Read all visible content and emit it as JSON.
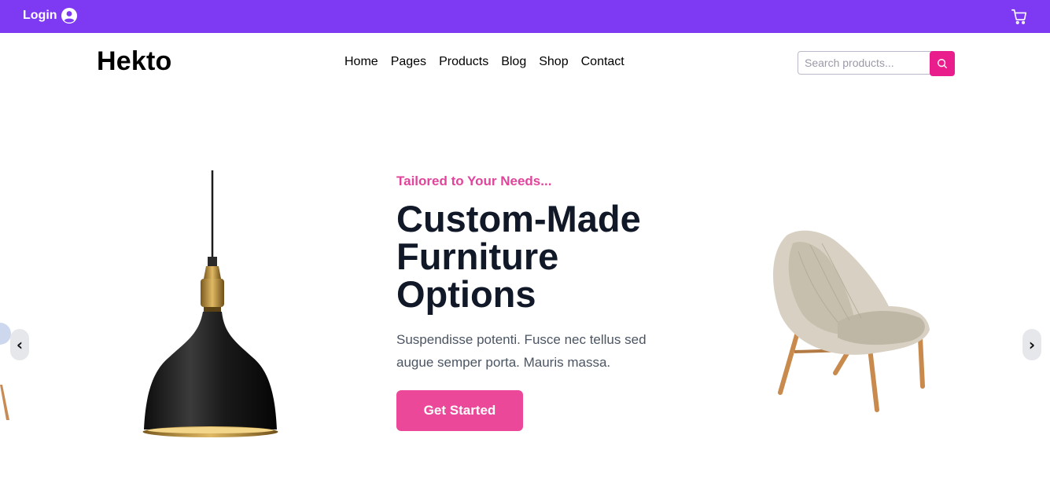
{
  "topbar": {
    "login_label": "Login",
    "user_icon": "user-circle-icon",
    "cart_icon": "cart-icon",
    "background": "#7e3af2"
  },
  "header": {
    "logo": "Hekto",
    "nav": [
      "Home",
      "Pages",
      "Products",
      "Blog",
      "Shop",
      "Contact"
    ],
    "search": {
      "placeholder": "Search products...",
      "value": "",
      "button_icon": "search-icon",
      "button_color": "#e91e8c"
    }
  },
  "hero": {
    "eyebrow": "Tailored to Your Needs...",
    "title": "Custom-Made Furniture Options",
    "description": "Suspendisse potenti. Fusce nec tellus sed augue semper porta. Mauris massa.",
    "cta_label": "Get Started",
    "accent": "#ec4899",
    "prev_label": "‹",
    "next_label": "›",
    "images": [
      "pendant-lamp",
      "lounge-chair"
    ]
  }
}
